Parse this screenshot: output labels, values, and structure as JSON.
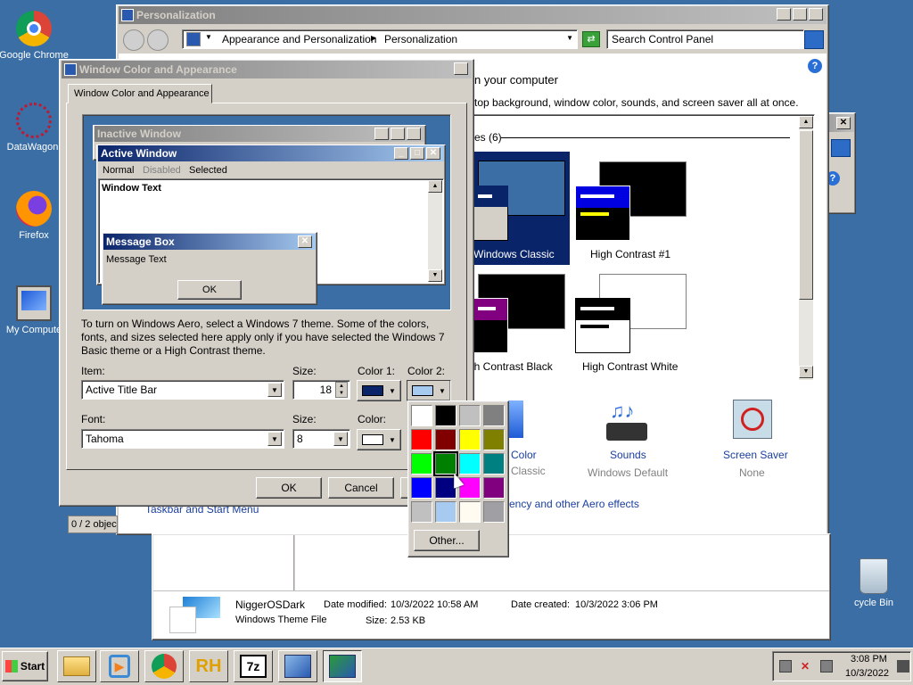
{
  "desktop": {
    "icons": [
      {
        "label": "Google Chrome"
      },
      {
        "label": "DataWagon."
      },
      {
        "label": "Firefox"
      },
      {
        "label": "My Compute"
      },
      {
        "label": "cycle Bin"
      }
    ]
  },
  "personalization": {
    "title": "Personalization",
    "breadcrumb": [
      "Appearance and Personalization",
      "Personalization"
    ],
    "search_placeholder": "Search Control Panel",
    "heading_partial": "n your computer",
    "subtext_partial": "top background, window color, sounds, and screen saver all at once.",
    "themes_header": "es (6)",
    "themes": [
      {
        "label": "Windows Classic",
        "selected": true
      },
      {
        "label": "High Contrast #1"
      },
      {
        "label": "gh Contrast Black"
      },
      {
        "label": "High Contrast White"
      }
    ],
    "bottom_items": [
      {
        "label": "Color",
        "sub": "Classic"
      },
      {
        "label": "Sounds",
        "sub": "Windows Default"
      },
      {
        "label": "Screen Saver",
        "sub": "None"
      }
    ],
    "aero_link": "rency and other Aero effects",
    "taskbar_link": "Taskbar and Start Menu",
    "status": "0 / 2 objec",
    "details": {
      "name": "NiggerOSDark",
      "type": "Windows Theme File",
      "modified_label": "Date modified:",
      "modified": "10/3/2022 10:58 AM",
      "size_label": "Size:",
      "size": "2.53 KB",
      "created_label": "Date created:",
      "created": "10/3/2022 3:06 PM"
    }
  },
  "dialog": {
    "title": "Window Color and Appearance",
    "tab": "Window Color and Appearance",
    "preview": {
      "inactive_title": "Inactive Window",
      "active_title": "Active Window",
      "menu": [
        "Normal",
        "Disabled",
        "Selected"
      ],
      "window_text": "Window Text",
      "msgbox_title": "Message Box",
      "msgbox_text": "Message Text",
      "ok": "OK"
    },
    "info": "To turn on Windows Aero, select a Windows 7 theme.  Some of the colors, fonts, and sizes selected here apply only if you have selected the Windows 7 Basic theme or a High Contrast theme.",
    "item_label": "Item:",
    "item_value": "Active Title Bar",
    "size_label": "Size:",
    "size_value": "18",
    "color1_label": "Color 1:",
    "color2_label": "Color 2:",
    "font_label": "Font:",
    "font_value": "Tahoma",
    "font_size_label": "Size:",
    "font_size_value": "8",
    "color_label": "Color:",
    "ok": "OK",
    "cancel": "Cancel"
  },
  "palette": {
    "colors": [
      "#ffffff",
      "#000000",
      "#c0c0c0",
      "#808080",
      "#ff0000",
      "#800000",
      "#ffff00",
      "#808000",
      "#00ff00",
      "#008000",
      "#00ffff",
      "#008080",
      "#0000ff",
      "#000080",
      "#ff00ff",
      "#800080",
      "#c0c0c0",
      "#a6caf0",
      "#fffbf0",
      "#a0a0a4"
    ],
    "other": "Other..."
  },
  "taskbar": {
    "start": "Start",
    "time": "3:08 PM",
    "date": "10/3/2022"
  }
}
